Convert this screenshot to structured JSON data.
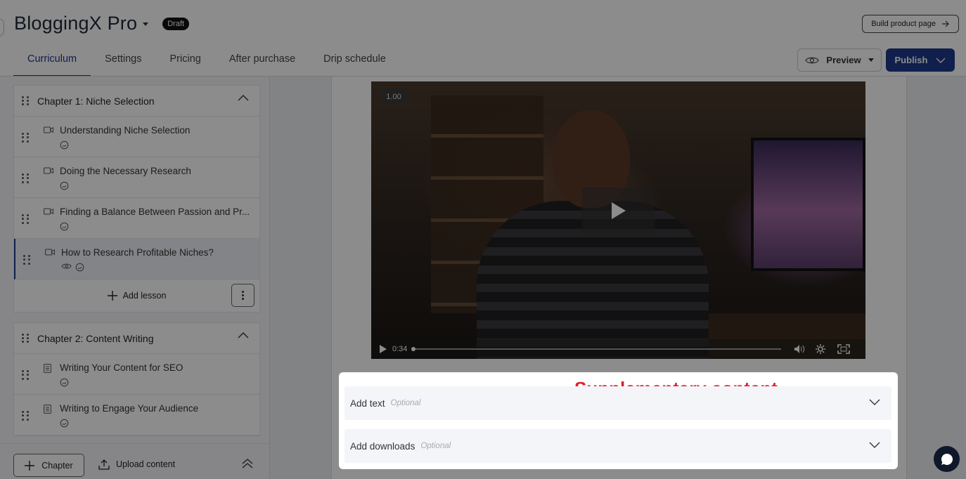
{
  "header": {
    "product_title": "BloggingX Pro",
    "status_badge": "Draft",
    "build_button": "Build product page",
    "tabs": [
      {
        "label": "Curriculum",
        "active": true
      },
      {
        "label": "Settings",
        "active": false
      },
      {
        "label": "Pricing",
        "active": false
      },
      {
        "label": "After purchase",
        "active": false
      },
      {
        "label": "Drip schedule",
        "active": false
      }
    ],
    "preview_button": "Preview",
    "publish_button": "Publish"
  },
  "sidebar": {
    "chapters": [
      {
        "title": "Chapter 1: Niche Selection",
        "lessons": [
          {
            "title": "Understanding Niche Selection",
            "type": "video",
            "icons": [
              "comment-icon"
            ]
          },
          {
            "title": "Doing the Necessary Research",
            "type": "video",
            "icons": [
              "comment-icon"
            ]
          },
          {
            "title": "Finding a Balance Between Passion and Pr...",
            "type": "video",
            "icons": [
              "comment-icon"
            ]
          },
          {
            "title": "How to Research Profitable Niches?",
            "type": "video",
            "icons": [
              "eye-icon",
              "comment-icon"
            ],
            "active": true
          }
        ],
        "add_lesson": "Add lesson"
      },
      {
        "title": "Chapter 2: Content Writing",
        "lessons": [
          {
            "title": "Writing Your Content for SEO",
            "type": "document",
            "icons": [
              "comment-icon"
            ]
          },
          {
            "title": "Writing to Engage Your Audience",
            "type": "document",
            "icons": [
              "comment-icon"
            ]
          }
        ]
      }
    ],
    "footer": {
      "chapter_button": "Chapter",
      "upload_button": "Upload content"
    }
  },
  "video_player": {
    "speed": "1.00",
    "current_time": "0:34",
    "progress_fraction": 0.004
  },
  "supplementary": {
    "annotation": "Supplementary content",
    "sections": [
      {
        "title": "Add text",
        "hint": "Optional"
      },
      {
        "title": "Add downloads",
        "hint": "Optional"
      }
    ]
  },
  "colors": {
    "accent": "#1e3a8a",
    "annotation_red": "#e11d2e"
  }
}
